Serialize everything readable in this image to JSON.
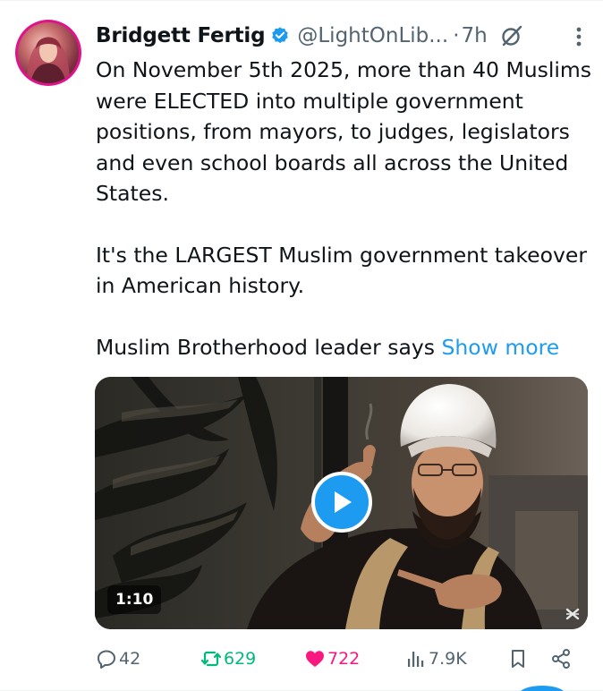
{
  "author": {
    "name": "Bridgett Fertig",
    "handle": "@LightOnLib...",
    "separator": "·",
    "time": "7h"
  },
  "tweet": {
    "paragraph_1": "On November 5th 2025, more than 40 Muslims were ELECTED into multiple government positions, from mayors, to judges, legislators and even school boards all across the United States.",
    "paragraph_2": "It's the LARGEST Muslim government takeover in American history.",
    "paragraph_3": "Muslim Brotherhood leader says ",
    "show_more": "Show more"
  },
  "media": {
    "duration": "1:10"
  },
  "actions": {
    "replies": "42",
    "reposts": "629",
    "likes": "722",
    "views": "7.9K"
  },
  "colors": {
    "accent": "#1d9bf0",
    "repost": "#00ba7c",
    "like": "#f91880",
    "secondary_text": "#536471",
    "avatar_ring": "#e0138c"
  },
  "icons": [
    "verified-badge-icon",
    "grok-icon",
    "more-options-icon",
    "play-icon",
    "reply-icon",
    "repost-icon",
    "like-icon",
    "views-icon",
    "bookmark-icon",
    "share-icon"
  ]
}
